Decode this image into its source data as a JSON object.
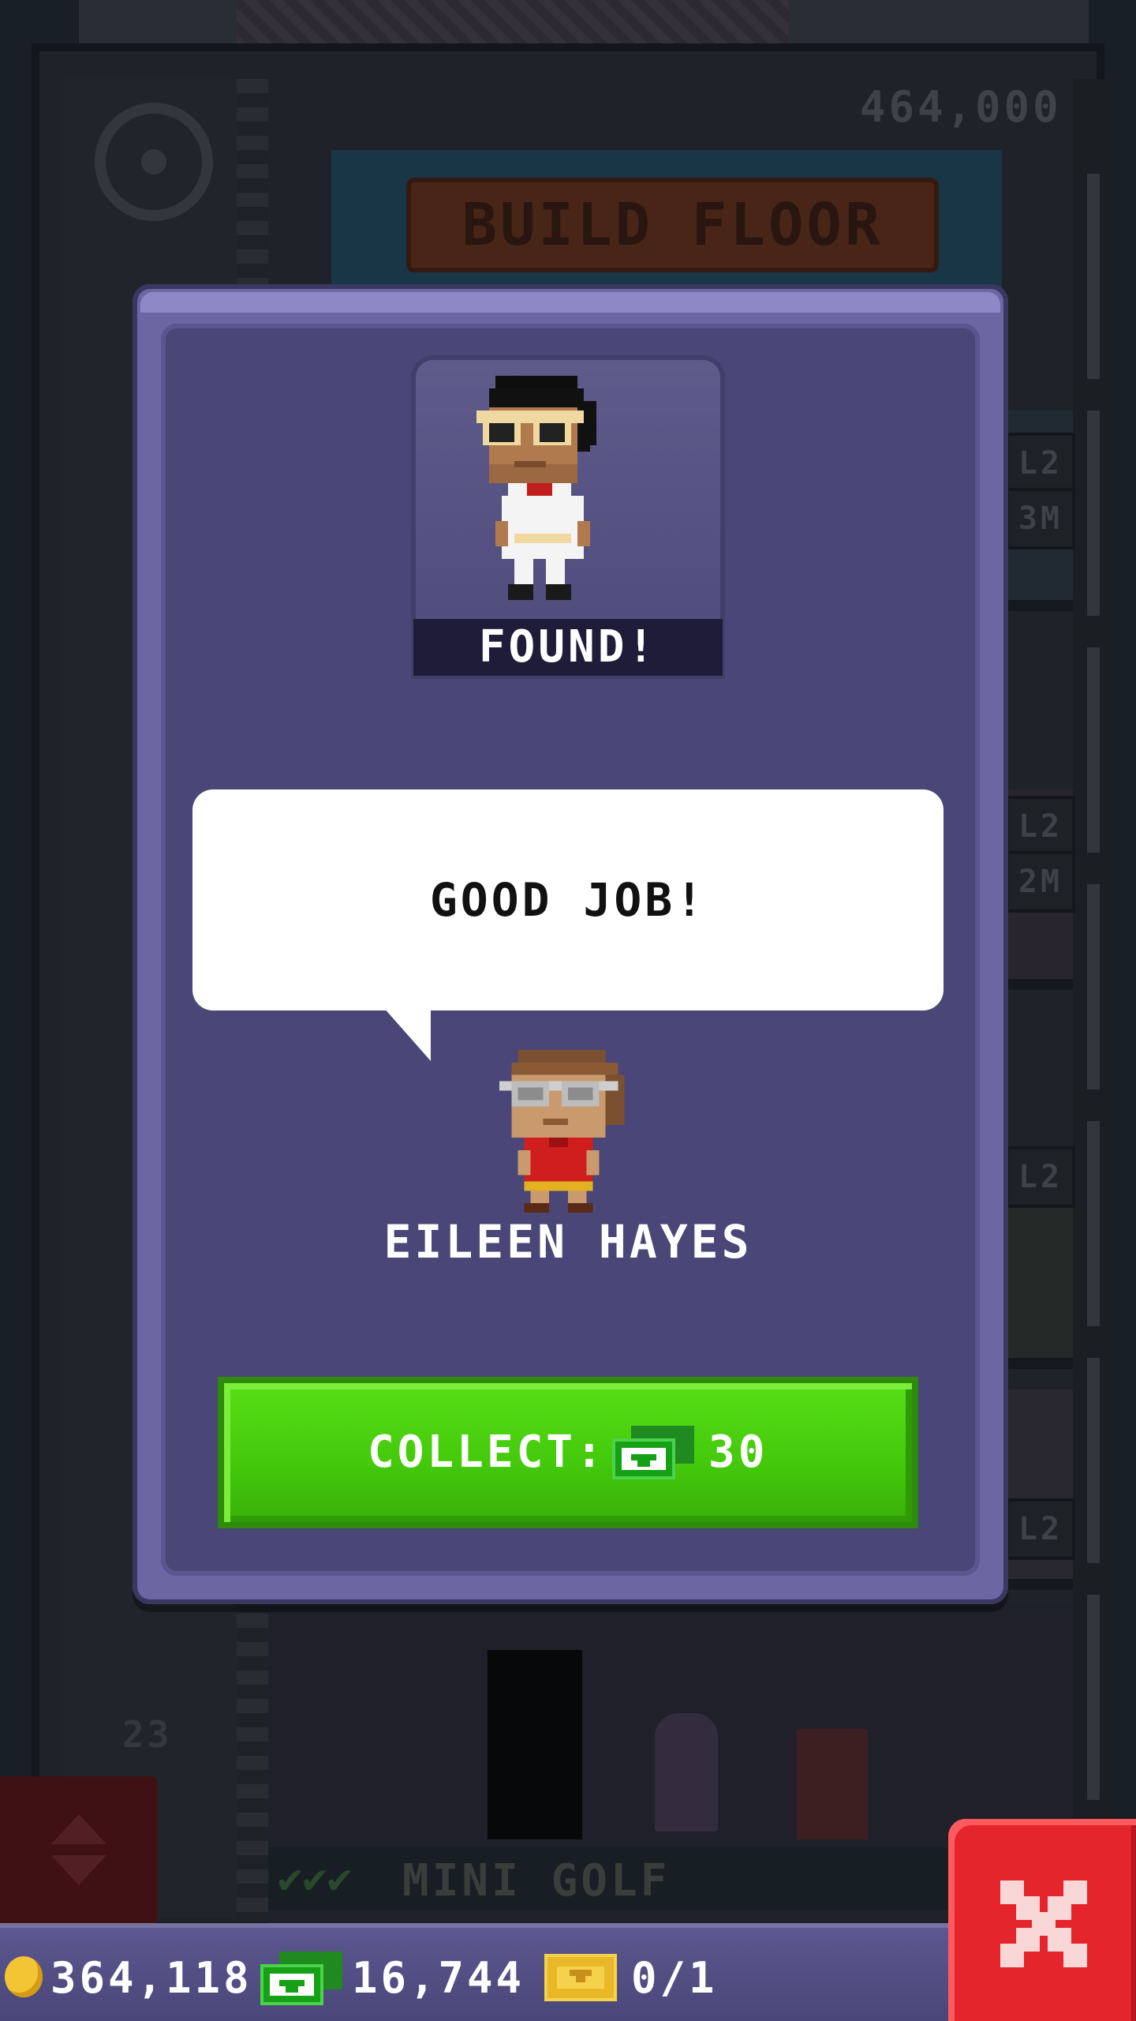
{
  "background": {
    "build_floor_label": "BUILD FLOOR",
    "build_floor_cost": "464,000",
    "side_tags": [
      "L2",
      "3M",
      "L2",
      "2M",
      "L2",
      "L2"
    ],
    "floor_number": "23",
    "lobby_floor_name": "MINI GOLF"
  },
  "modal": {
    "found_label": "FOUND!",
    "speech_text": "GOOD JOB!",
    "character_name": "EILEEN HAYES",
    "collect_label": "COLLECT:",
    "collect_amount": "30",
    "colors": {
      "panel": "#6c66a3",
      "inner": "#4a4677",
      "collect_button": "#43c80b"
    }
  },
  "currency": {
    "coins": "364,118",
    "bux": "16,744",
    "tickets": "0/1"
  },
  "icons": {
    "coin": "coin-icon",
    "bux": "tower-bux-icon",
    "ticket": "golden-ticket-icon",
    "close": "close-icon",
    "elevator": "elevator-arrows-icon"
  }
}
